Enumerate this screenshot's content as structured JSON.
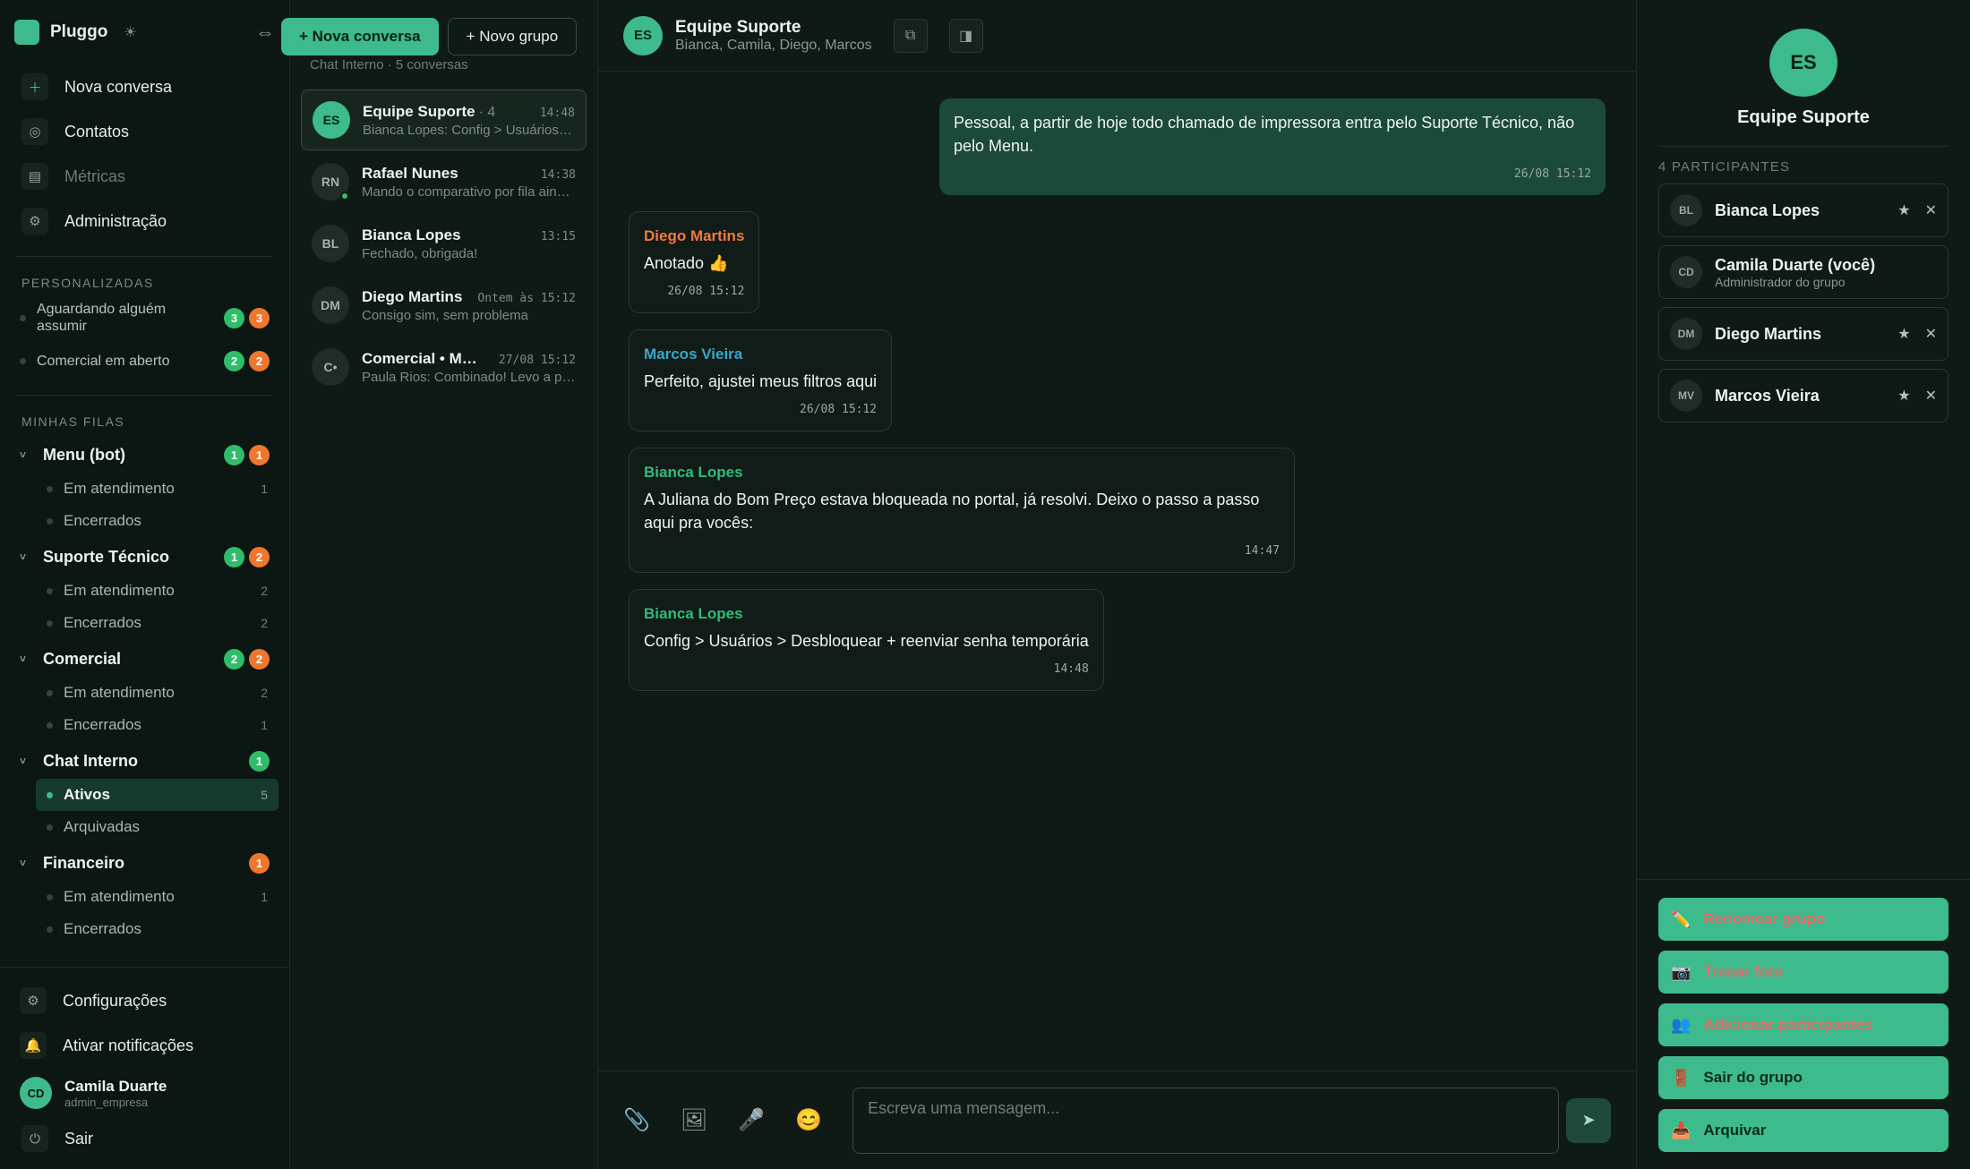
{
  "brand": {
    "name": "Pluggo",
    "accent": "#3dbb8d"
  },
  "sidebar": {
    "nav": [
      {
        "label": "Nova conversa",
        "icon": "plus-icon"
      },
      {
        "label": "Contatos",
        "icon": "contacts-icon"
      },
      {
        "label": "Métricas",
        "icon": "metrics-icon"
      },
      {
        "label": "Administração",
        "icon": "gear-icon"
      }
    ],
    "custom_header": "PERSONALIZADAS",
    "custom": [
      {
        "label": "Aguardando alguém assumir",
        "badges": [
          "3",
          "3"
        ]
      },
      {
        "label": "Comercial em aberto",
        "badges": [
          "2",
          "2"
        ]
      }
    ],
    "queues_header": "MINHAS FILAS",
    "queues": [
      {
        "name": "Menu (bot)",
        "badges": [
          "1",
          "1"
        ],
        "subs": [
          {
            "label": "Em atendimento",
            "count": "1"
          },
          {
            "label": "Encerrados",
            "count": ""
          }
        ]
      },
      {
        "name": "Suporte Técnico",
        "badges": [
          "1",
          "2"
        ],
        "subs": [
          {
            "label": "Em atendimento",
            "count": "2"
          },
          {
            "label": "Encerrados",
            "count": "2"
          }
        ]
      },
      {
        "name": "Comercial",
        "badges": [
          "2",
          "2"
        ],
        "subs": [
          {
            "label": "Em atendimento",
            "count": "2"
          },
          {
            "label": "Encerrados",
            "count": "1"
          }
        ]
      },
      {
        "name": "Chat Interno",
        "badges": [
          "1"
        ],
        "subs": [
          {
            "label": "Ativos",
            "count": "5"
          },
          {
            "label": "Arquivadas",
            "count": ""
          }
        ]
      },
      {
        "name": "Financeiro",
        "badges": [
          "1"
        ],
        "subs": [
          {
            "label": "Em atendimento",
            "count": "1"
          },
          {
            "label": "Encerrados",
            "count": ""
          }
        ]
      }
    ],
    "bottom": [
      {
        "label": "Configurações",
        "icon": "gear-icon"
      },
      {
        "label": "Ativar notificações",
        "icon": "bell-icon"
      }
    ],
    "user": {
      "initials": "CD",
      "name": "Camila Duarte",
      "role": "admin_empresa"
    },
    "logout": "Sair"
  },
  "convlist": {
    "new_conv": "+ Nova conversa",
    "new_group": "+ Novo grupo",
    "subtitle": "Chat Interno · 5 conversas",
    "items": [
      {
        "initials": "ES",
        "name": "Equipe Suporte",
        "extra": "· 4",
        "time": "14:48",
        "preview": "Bianca Lopes: Config > Usuários > Desbloquear"
      },
      {
        "initials": "RN",
        "name": "Rafael Nunes",
        "extra": "",
        "time": "14:38",
        "preview": "Mando o comparativo por fila ainda hoje"
      },
      {
        "initials": "BL",
        "name": "Bianca Lopes",
        "extra": "",
        "time": "13:15",
        "preview": "Fechado, obrigada!"
      },
      {
        "initials": "DM",
        "name": "Diego Martins",
        "extra": "",
        "time": "Ontem às 15:12",
        "preview": "Consigo sim, sem problema"
      },
      {
        "initials": "C•",
        "name": "Comercial • M…",
        "extra": "",
        "time": "27/08 15:12",
        "preview": "Paula Rios: Combinado! Levo a proposta"
      }
    ]
  },
  "chat": {
    "initials": "ES",
    "title": "Equipe Suporte",
    "members": "Bianca, Camila, Diego, Marcos",
    "messages": [
      {
        "dir": "out",
        "sender": "",
        "color": "",
        "text": "Pessoal, a partir de hoje todo chamado de impressora entra pelo Suporte Técnico, não pelo Menu.",
        "time": "26/08 15:12"
      },
      {
        "dir": "in",
        "sender": "Diego Martins",
        "color": "#f07a3e",
        "text": "Anotado 👍",
        "time": "26/08 15:12"
      },
      {
        "dir": "in",
        "sender": "Marcos Vieira",
        "color": "#3aa7c9",
        "text": "Perfeito, ajustei meus filtros aqui",
        "time": "26/08 15:12"
      },
      {
        "dir": "in",
        "sender": "Bianca Lopes",
        "color": "#2fbd7a",
        "text": "A Juliana do Bom Preço estava bloqueada no portal, já resolvi. Deixo o passo a passo aqui pra vocês:",
        "time": "14:47"
      },
      {
        "dir": "in",
        "sender": "Bianca Lopes",
        "color": "#2fbd7a",
        "text": "Config > Usuários > Desbloquear + reenviar senha temporária",
        "time": "14:48"
      }
    ],
    "placeholder": "Escreva uma mensagem..."
  },
  "info": {
    "initials": "ES",
    "name": "Equipe Suporte",
    "participants_header": "4 PARTICIPANTES",
    "participants": [
      {
        "initials": "BL",
        "name": "Bianca Lopes",
        "role": "",
        "actions": true
      },
      {
        "initials": "CD",
        "name": "Camila Duarte (você)",
        "role": "Administrador do grupo",
        "actions": false
      },
      {
        "initials": "DM",
        "name": "Diego Martins",
        "role": "",
        "actions": true
      },
      {
        "initials": "MV",
        "name": "Marcos Vieira",
        "role": "",
        "actions": true
      }
    ],
    "actions": [
      {
        "label": "Renomear grupo",
        "icon": "pencil-icon",
        "glyph": "✏️",
        "style": "warn"
      },
      {
        "label": "Trocar foto",
        "icon": "camera-icon",
        "glyph": "📷",
        "style": "warn"
      },
      {
        "label": "Adicionar participantes",
        "icon": "people-icon",
        "glyph": "👥",
        "style": "warn"
      },
      {
        "label": "Sair do grupo",
        "icon": "door-icon",
        "glyph": "🚪",
        "style": "norm"
      },
      {
        "label": "Arquivar",
        "icon": "archive-icon",
        "glyph": "📥",
        "style": "norm"
      }
    ]
  }
}
